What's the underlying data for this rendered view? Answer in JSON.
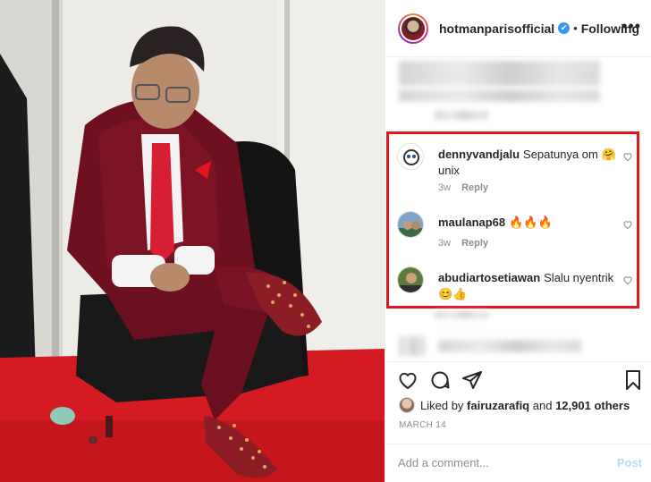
{
  "header": {
    "username": "hotmanparisofficial",
    "verified_icon": "✔",
    "separator": "•",
    "follow_status": "Following",
    "more_icon": "•••"
  },
  "comments": [
    {
      "username": "dennyvandjalu",
      "text": "Sepatunya om 🤗 unix",
      "age": "3w",
      "reply": "Reply"
    },
    {
      "username": "maulanap68",
      "text": "🔥🔥🔥",
      "age": "3w",
      "reply": "Reply"
    },
    {
      "username": "abudiartosetiawan",
      "text": "Slalu nyentrik 😊👍",
      "age": "",
      "reply": ""
    }
  ],
  "likes": {
    "prefix": "Liked by",
    "user": "fairuzarafiq",
    "and": "and",
    "count": "12,901 others"
  },
  "date": "MARCH 14",
  "add_comment": {
    "placeholder": "Add a comment...",
    "post_label": "Post"
  },
  "colors": {
    "highlight_box": "#e8141b",
    "verified": "#3897f0",
    "post_disabled": "#b3dbff"
  }
}
